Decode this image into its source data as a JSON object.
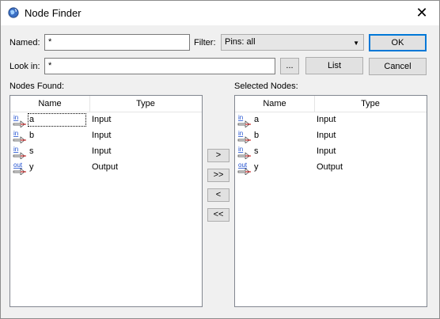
{
  "window": {
    "title": "Node Finder",
    "close_glyph": "✕"
  },
  "named": {
    "label": "Named:",
    "value": "*"
  },
  "filter": {
    "label": "Filter:",
    "value": "Pins: all"
  },
  "look_in": {
    "label": "Look in:",
    "value": "*",
    "browse_label": "..."
  },
  "buttons": {
    "ok": "OK",
    "list": "List",
    "cancel": "Cancel",
    "add": ">",
    "add_all": ">>",
    "remove": "<",
    "remove_all": "<<"
  },
  "found": {
    "label": "Nodes Found:",
    "columns": [
      "Name",
      "Type"
    ],
    "rows": [
      {
        "icon": "in",
        "name": "a",
        "type": "Input"
      },
      {
        "icon": "in",
        "name": "b",
        "type": "Input"
      },
      {
        "icon": "in",
        "name": "s",
        "type": "Input"
      },
      {
        "icon": "out",
        "name": "y",
        "type": "Output"
      }
    ]
  },
  "selected": {
    "label": "Selected Nodes:",
    "columns": [
      "Name",
      "Type"
    ],
    "rows": [
      {
        "icon": "in",
        "name": "a",
        "type": "Input"
      },
      {
        "icon": "in",
        "name": "b",
        "type": "Input"
      },
      {
        "icon": "in",
        "name": "s",
        "type": "Input"
      },
      {
        "icon": "out",
        "name": "y",
        "type": "Output"
      }
    ]
  },
  "colors": {
    "accent": "#0078d7",
    "pin_in": "#1f4fd0",
    "pin_out": "#1f4fd0",
    "pin_arrow": "#c00000"
  }
}
